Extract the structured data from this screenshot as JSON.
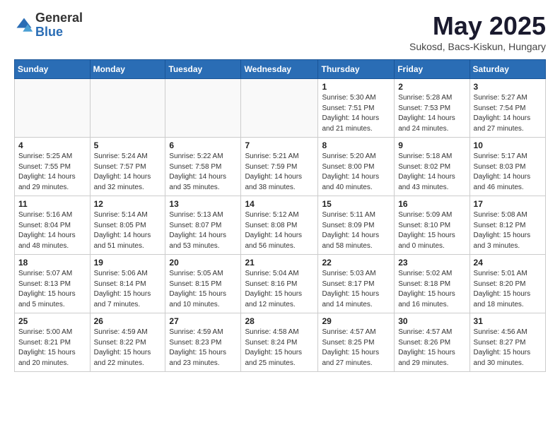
{
  "header": {
    "logo_general": "General",
    "logo_blue": "Blue",
    "month_title": "May 2025",
    "location": "Sukosd, Bacs-Kiskun, Hungary"
  },
  "weekdays": [
    "Sunday",
    "Monday",
    "Tuesday",
    "Wednesday",
    "Thursday",
    "Friday",
    "Saturday"
  ],
  "weeks": [
    [
      {
        "day": "",
        "info": ""
      },
      {
        "day": "",
        "info": ""
      },
      {
        "day": "",
        "info": ""
      },
      {
        "day": "",
        "info": ""
      },
      {
        "day": "1",
        "info": "Sunrise: 5:30 AM\nSunset: 7:51 PM\nDaylight: 14 hours\nand 21 minutes."
      },
      {
        "day": "2",
        "info": "Sunrise: 5:28 AM\nSunset: 7:53 PM\nDaylight: 14 hours\nand 24 minutes."
      },
      {
        "day": "3",
        "info": "Sunrise: 5:27 AM\nSunset: 7:54 PM\nDaylight: 14 hours\nand 27 minutes."
      }
    ],
    [
      {
        "day": "4",
        "info": "Sunrise: 5:25 AM\nSunset: 7:55 PM\nDaylight: 14 hours\nand 29 minutes."
      },
      {
        "day": "5",
        "info": "Sunrise: 5:24 AM\nSunset: 7:57 PM\nDaylight: 14 hours\nand 32 minutes."
      },
      {
        "day": "6",
        "info": "Sunrise: 5:22 AM\nSunset: 7:58 PM\nDaylight: 14 hours\nand 35 minutes."
      },
      {
        "day": "7",
        "info": "Sunrise: 5:21 AM\nSunset: 7:59 PM\nDaylight: 14 hours\nand 38 minutes."
      },
      {
        "day": "8",
        "info": "Sunrise: 5:20 AM\nSunset: 8:00 PM\nDaylight: 14 hours\nand 40 minutes."
      },
      {
        "day": "9",
        "info": "Sunrise: 5:18 AM\nSunset: 8:02 PM\nDaylight: 14 hours\nand 43 minutes."
      },
      {
        "day": "10",
        "info": "Sunrise: 5:17 AM\nSunset: 8:03 PM\nDaylight: 14 hours\nand 46 minutes."
      }
    ],
    [
      {
        "day": "11",
        "info": "Sunrise: 5:16 AM\nSunset: 8:04 PM\nDaylight: 14 hours\nand 48 minutes."
      },
      {
        "day": "12",
        "info": "Sunrise: 5:14 AM\nSunset: 8:05 PM\nDaylight: 14 hours\nand 51 minutes."
      },
      {
        "day": "13",
        "info": "Sunrise: 5:13 AM\nSunset: 8:07 PM\nDaylight: 14 hours\nand 53 minutes."
      },
      {
        "day": "14",
        "info": "Sunrise: 5:12 AM\nSunset: 8:08 PM\nDaylight: 14 hours\nand 56 minutes."
      },
      {
        "day": "15",
        "info": "Sunrise: 5:11 AM\nSunset: 8:09 PM\nDaylight: 14 hours\nand 58 minutes."
      },
      {
        "day": "16",
        "info": "Sunrise: 5:09 AM\nSunset: 8:10 PM\nDaylight: 15 hours\nand 0 minutes."
      },
      {
        "day": "17",
        "info": "Sunrise: 5:08 AM\nSunset: 8:12 PM\nDaylight: 15 hours\nand 3 minutes."
      }
    ],
    [
      {
        "day": "18",
        "info": "Sunrise: 5:07 AM\nSunset: 8:13 PM\nDaylight: 15 hours\nand 5 minutes."
      },
      {
        "day": "19",
        "info": "Sunrise: 5:06 AM\nSunset: 8:14 PM\nDaylight: 15 hours\nand 7 minutes."
      },
      {
        "day": "20",
        "info": "Sunrise: 5:05 AM\nSunset: 8:15 PM\nDaylight: 15 hours\nand 10 minutes."
      },
      {
        "day": "21",
        "info": "Sunrise: 5:04 AM\nSunset: 8:16 PM\nDaylight: 15 hours\nand 12 minutes."
      },
      {
        "day": "22",
        "info": "Sunrise: 5:03 AM\nSunset: 8:17 PM\nDaylight: 15 hours\nand 14 minutes."
      },
      {
        "day": "23",
        "info": "Sunrise: 5:02 AM\nSunset: 8:18 PM\nDaylight: 15 hours\nand 16 minutes."
      },
      {
        "day": "24",
        "info": "Sunrise: 5:01 AM\nSunset: 8:20 PM\nDaylight: 15 hours\nand 18 minutes."
      }
    ],
    [
      {
        "day": "25",
        "info": "Sunrise: 5:00 AM\nSunset: 8:21 PM\nDaylight: 15 hours\nand 20 minutes."
      },
      {
        "day": "26",
        "info": "Sunrise: 4:59 AM\nSunset: 8:22 PM\nDaylight: 15 hours\nand 22 minutes."
      },
      {
        "day": "27",
        "info": "Sunrise: 4:59 AM\nSunset: 8:23 PM\nDaylight: 15 hours\nand 23 minutes."
      },
      {
        "day": "28",
        "info": "Sunrise: 4:58 AM\nSunset: 8:24 PM\nDaylight: 15 hours\nand 25 minutes."
      },
      {
        "day": "29",
        "info": "Sunrise: 4:57 AM\nSunset: 8:25 PM\nDaylight: 15 hours\nand 27 minutes."
      },
      {
        "day": "30",
        "info": "Sunrise: 4:57 AM\nSunset: 8:26 PM\nDaylight: 15 hours\nand 29 minutes."
      },
      {
        "day": "31",
        "info": "Sunrise: 4:56 AM\nSunset: 8:27 PM\nDaylight: 15 hours\nand 30 minutes."
      }
    ]
  ]
}
